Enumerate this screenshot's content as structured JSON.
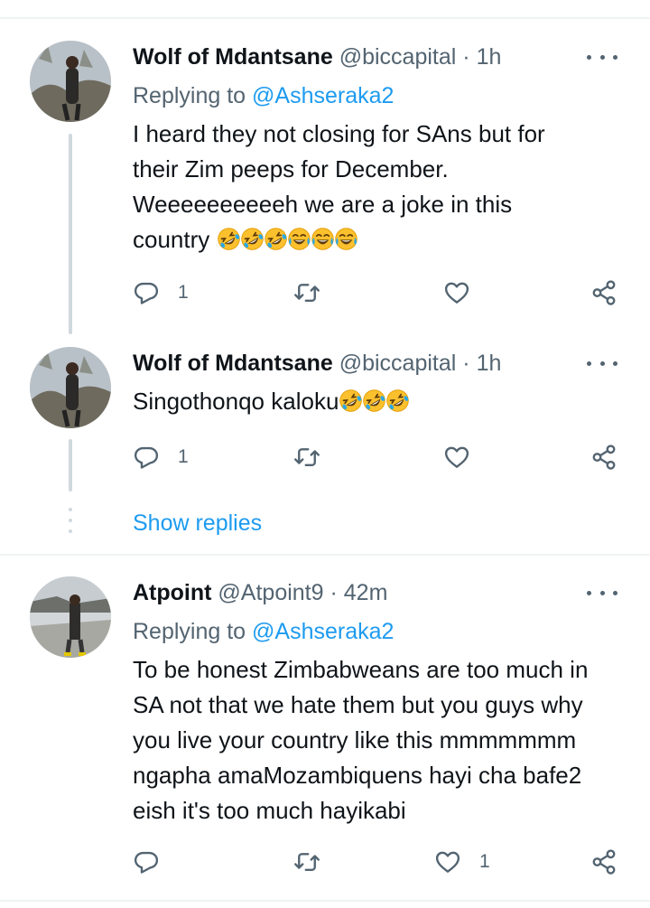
{
  "tweets": [
    {
      "name": "Wolf of Mdantsane",
      "handle": "@biccapital",
      "sep": "·",
      "time": "1h",
      "replying_prefix": "Replying to",
      "replying_handle": "@Ashseraka2",
      "text_lines": [
        "I heard they not closing for SAns but for",
        "their Zim peeps for December.",
        "Weeeeeeeeeeh we are a joke in this"
      ],
      "last_line_text": "country",
      "emojis": [
        "rolling-on-floor-laughing",
        "rolling-on-floor-laughing",
        "rolling-on-floor-laughing",
        "tears-of-joy",
        "tears-of-joy",
        "tears-of-joy"
      ],
      "reply_count": "1",
      "retweet_count": "",
      "like_count": ""
    },
    {
      "name": "Wolf of Mdantsane",
      "handle": "@biccapital",
      "sep": "·",
      "time": "1h",
      "text": "Singothonqo kaloku",
      "emojis": [
        "rolling-on-floor-laughing",
        "rolling-on-floor-laughing",
        "rolling-on-floor-laughing"
      ],
      "reply_count": "1",
      "retweet_count": "",
      "like_count": ""
    },
    {
      "name": "Atpoint",
      "handle": "@Atpoint9",
      "sep": "·",
      "time": "42m",
      "replying_prefix": "Replying to",
      "replying_handle": "@Ashseraka2",
      "text_lines": [
        "To be honest Zimbabweans are too much in",
        "SA not that we hate them but you guys why",
        "you live your country like this mmmmmmm",
        "ngapha amaMozambiquens hayi cha bafe2",
        "eish it's too much hayikabi"
      ],
      "reply_count": "",
      "retweet_count": "",
      "like_count": "1"
    }
  ],
  "show_replies": "Show replies",
  "icons": {
    "reply": "reply-icon",
    "retweet": "retweet-icon",
    "like": "heart-icon",
    "share": "share-icon",
    "more": "more-icon"
  },
  "colors": {
    "link": "#1d9bf0",
    "secondary": "#536471",
    "text": "#0f1419",
    "divider": "#eff3f4"
  }
}
